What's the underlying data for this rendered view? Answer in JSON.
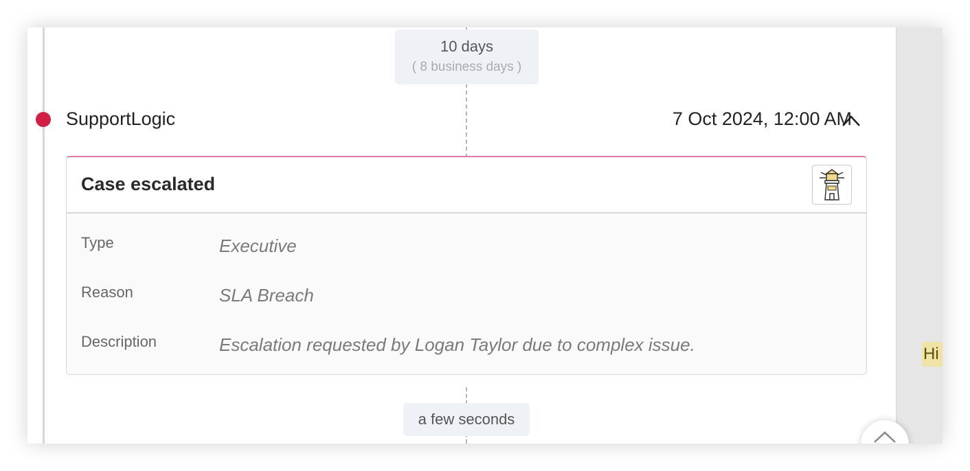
{
  "timeline": {
    "gap_before": {
      "duration": "10 days",
      "business_duration": "( 8 business days )"
    },
    "event": {
      "source": "SupportLogic",
      "datetime": "7 Oct 2024, 12:00 AM",
      "dot_color": "#d11f45",
      "collapse_icon": "chevron-up-icon",
      "card": {
        "title": "Case escalated",
        "icon": "lighthouse-icon",
        "fields": [
          {
            "label": "Type",
            "value": "Executive"
          },
          {
            "label": "Reason",
            "value": "SLA Breach"
          },
          {
            "label": "Description",
            "value": "Escalation requested by Logan Taylor due to complex issue."
          }
        ]
      }
    },
    "gap_after": {
      "duration": "a few seconds"
    }
  },
  "side_panel": {
    "tag_text": "Hi"
  },
  "scroll_top_icon": "chevron-up-icon"
}
